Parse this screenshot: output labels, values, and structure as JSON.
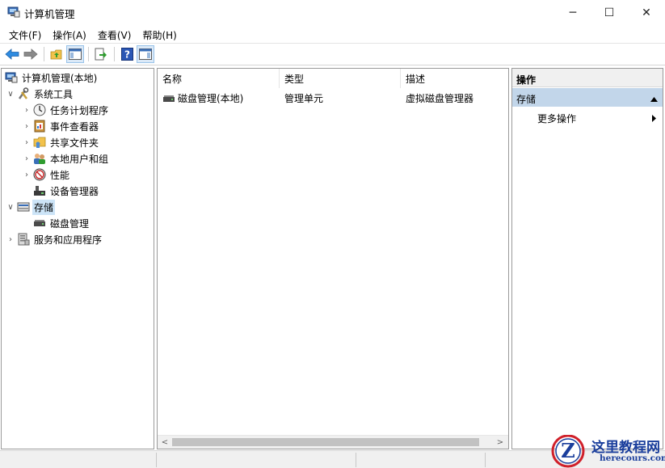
{
  "window": {
    "title": "计算机管理",
    "controls": {
      "minimize": "─",
      "maximize": "☐",
      "close": "✕"
    }
  },
  "menu": [
    "文件(F)",
    "操作(A)",
    "查看(V)",
    "帮助(H)"
  ],
  "toolbar": {
    "buttons": [
      "back-icon",
      "forward-icon",
      "up-folder-icon",
      "show-hide-tree-icon",
      "export-list-icon",
      "help-icon",
      "show-hide-action-pane-icon"
    ],
    "help_glyph": "?"
  },
  "tree": {
    "root": "计算机管理(本地)",
    "system_tools": "系统工具",
    "task_scheduler": "任务计划程序",
    "event_viewer": "事件查看器",
    "shared_folders": "共享文件夹",
    "local_users": "本地用户和组",
    "performance": "性能",
    "device_manager": "设备管理器",
    "storage": "存储",
    "disk_management": "磁盘管理",
    "services": "服务和应用程序"
  },
  "list": {
    "columns": [
      "名称",
      "类型",
      "描述"
    ],
    "rows": [
      {
        "name": "磁盘管理(本地)",
        "type": "管理单元",
        "description": "虚拟磁盘管理器"
      }
    ]
  },
  "actions": {
    "header": "操作",
    "section": "存储",
    "more": "更多操作"
  },
  "watermark": {
    "logo_letter": "Z",
    "title": "这里教程网",
    "url": "herecours.com"
  },
  "colors": {
    "selection": "#cce4f7",
    "action_section": "#c2d6ea",
    "watermark_blue": "#1a3e9c",
    "watermark_red": "#d0202a"
  }
}
